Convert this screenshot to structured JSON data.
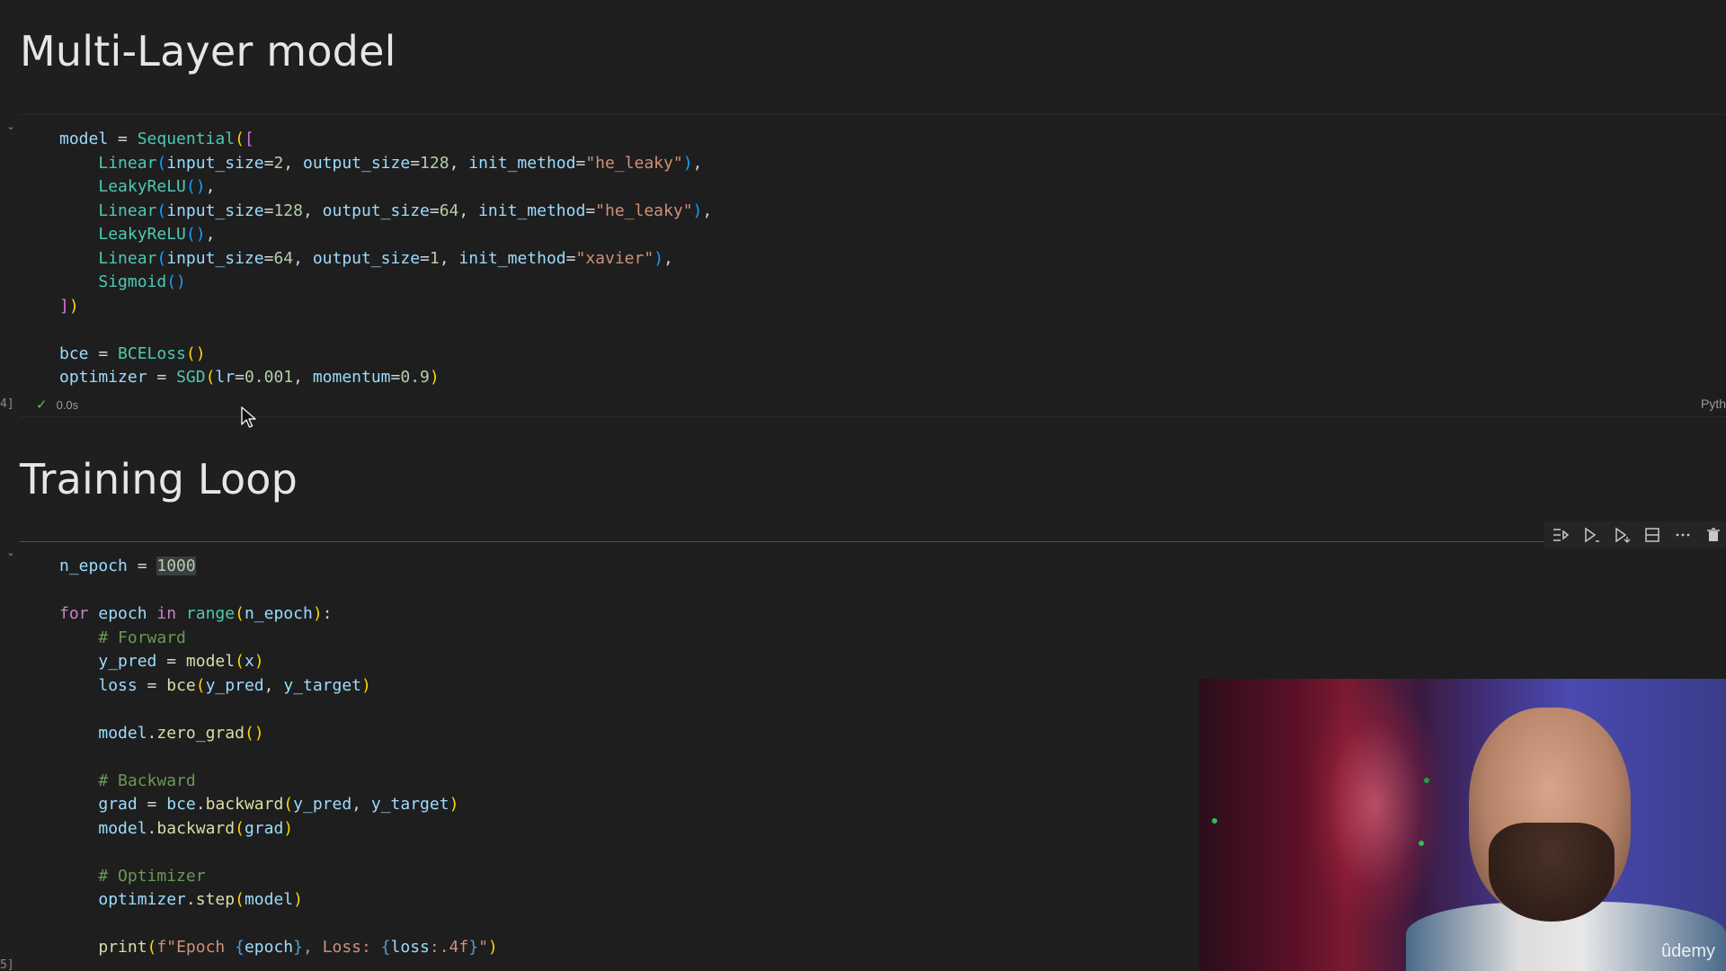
{
  "headings": {
    "multi_layer": "Multi-Layer model",
    "training_loop": "Training Loop"
  },
  "cell1": {
    "exec_count": "4]",
    "status_time": "0.0s",
    "language": "Pyth",
    "collapse_icon": "chevron-down-icon",
    "status_icon": "check-icon",
    "code": {
      "l1_a": "model",
      "l1_b": " = ",
      "l1_c": "Sequential",
      "l1_d": "(",
      "l1_e": "[",
      "l2_fn": "Linear",
      "l2_p1": "input_size",
      "l2_v1": "2",
      "l2_p2": "output_size",
      "l2_v2": "128",
      "l2_p3": "init_method",
      "l2_v3": "\"he_leaky\"",
      "l3_fn": "LeakyReLU",
      "l4_fn": "Linear",
      "l4_p1": "input_size",
      "l4_v1": "128",
      "l4_p2": "output_size",
      "l4_v2": "64",
      "l4_p3": "init_method",
      "l4_v3": "\"he_leaky\"",
      "l5_fn": "LeakyReLU",
      "l6_fn": "Linear",
      "l6_p1": "input_size",
      "l6_v1": "64",
      "l6_p2": "output_size",
      "l6_v2": "1",
      "l6_p3": "init_method",
      "l6_v3": "\"xavier\"",
      "l7_fn": "Sigmoid",
      "l8": "])",
      "l10_a": "bce",
      "l10_fn": "BCELoss",
      "l11_a": "optimizer",
      "l11_fn": "SGD",
      "l11_p1": "lr",
      "l11_v1": "0.001",
      "l11_p2": "momentum",
      "l11_v2": "0.9"
    }
  },
  "cell2": {
    "exec_count": "5]",
    "collapse_icon": "chevron-down-icon",
    "toolbar": {
      "icons": [
        "run-by-line-icon",
        "execute-above-icon",
        "execute-below-icon",
        "split-cell-icon",
        "more-actions-icon",
        "delete-icon"
      ]
    },
    "code": {
      "l1_a": "n_epoch",
      "l1_v": "1000",
      "l3_kw1": "for",
      "l3_v": "epoch",
      "l3_kw2": "in",
      "l3_fn": "range",
      "l3_arg": "n_epoch",
      "l4_cm": "# Forward",
      "l5_a": "y_pred",
      "l5_fn": "model",
      "l5_arg": "x",
      "l6_a": "loss",
      "l6_fn": "bce",
      "l6_arg1": "y_pred",
      "l6_arg2": "y_target",
      "l8_obj": "model",
      "l8_fn": "zero_grad",
      "l10_cm": "# Backward",
      "l11_a": "grad",
      "l11_obj": "bce",
      "l11_fn": "backward",
      "l11_arg1": "y_pred",
      "l11_arg2": "y_target",
      "l12_obj": "model",
      "l12_fn": "backward",
      "l12_arg": "grad",
      "l14_cm": "# Optimizer",
      "l15_obj": "optimizer",
      "l15_fn": "step",
      "l15_arg": "model",
      "l17_fn": "print",
      "l17_s1": "f\"Epoch ",
      "l17_v1": "epoch",
      "l17_s2": ", Loss: ",
      "l17_v2": "loss",
      "l17_fmt": ":.4f",
      "l17_s3": "\""
    }
  },
  "webcam": {
    "watermark": "ûdemy"
  }
}
